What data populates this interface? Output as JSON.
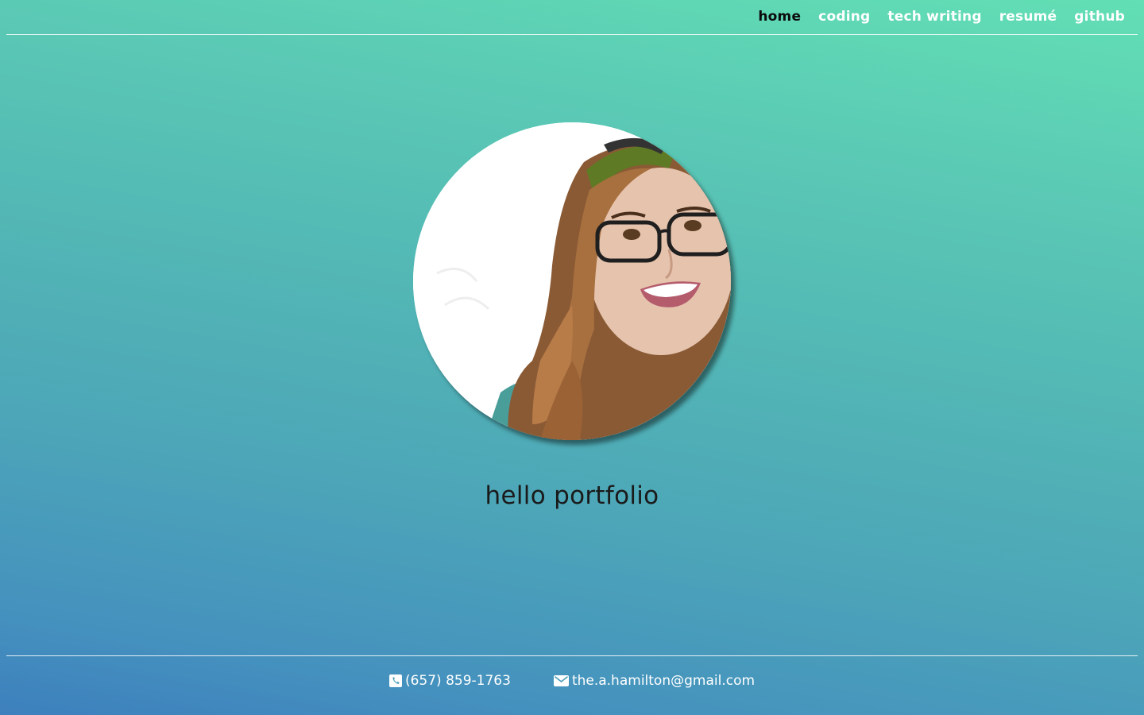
{
  "nav": {
    "items": [
      {
        "label": "home",
        "active": true
      },
      {
        "label": "coding",
        "active": false
      },
      {
        "label": "tech writing",
        "active": false
      },
      {
        "label": "resumé",
        "active": false
      },
      {
        "label": "github",
        "active": false
      }
    ]
  },
  "hero": {
    "avatar_description_icon": "illustrated-portrait",
    "headline": "hello portfolio"
  },
  "footer": {
    "phone": {
      "icon": "phone-icon",
      "text": "(657) 859-1763"
    },
    "email": {
      "icon": "envelope-icon",
      "text": "the.a.hamilton@gmail.com"
    }
  },
  "colors": {
    "gradient_top": "#62dfb4",
    "gradient_bottom": "#3d80bd",
    "nav_active": "#0b0b0b",
    "nav_inactive": "#ffffff",
    "headline": "#1a1a1a",
    "footer_text": "#ffffff"
  }
}
